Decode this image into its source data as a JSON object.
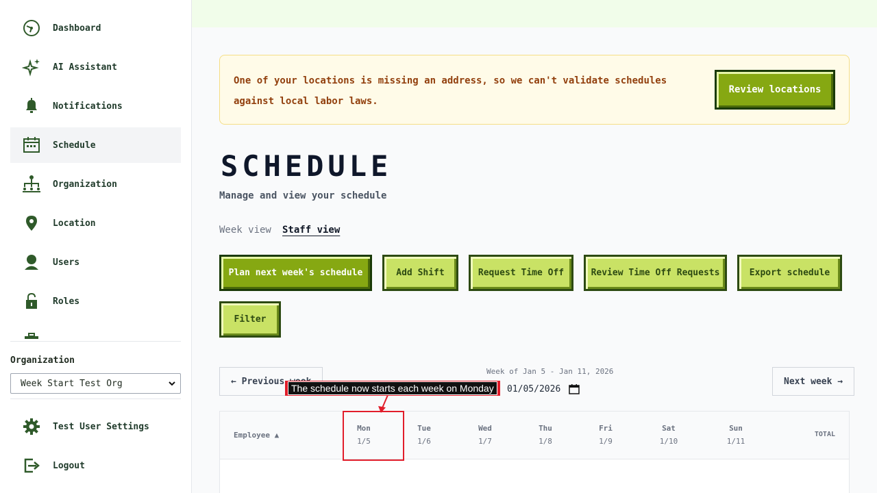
{
  "sidebar": {
    "items": [
      {
        "label": "Dashboard",
        "icon": "gauge-icon"
      },
      {
        "label": "AI Assistant",
        "icon": "sparkle-icon"
      },
      {
        "label": "Notifications",
        "icon": "bell-icon"
      },
      {
        "label": "Schedule",
        "icon": "calendar-icon",
        "active": true
      },
      {
        "label": "Organization",
        "icon": "org-chart-icon"
      },
      {
        "label": "Location",
        "icon": "map-pin-icon"
      },
      {
        "label": "Users",
        "icon": "user-icon"
      },
      {
        "label": "Roles",
        "icon": "lock-icon"
      }
    ],
    "org_label": "Organization",
    "org_selected": "Week Start Test Org",
    "settings_label": "Test User Settings",
    "logout_label": "Logout"
  },
  "alert": {
    "message": "One of your locations is missing an address, so we can't validate schedules against local labor laws.",
    "action_label": "Review locations"
  },
  "page": {
    "title": "SCHEDULE",
    "subtitle": "Manage and view your schedule"
  },
  "views": {
    "week_view": "Week view",
    "staff_view": "Staff view"
  },
  "actions": {
    "plan": "Plan next week's schedule",
    "add_shift": "Add Shift",
    "request_time_off": "Request Time Off",
    "review_time_off": "Review Time Off Requests",
    "export": "Export schedule",
    "filter": "Filter"
  },
  "week_nav": {
    "previous": "← Previous week",
    "next": "Next week →",
    "week_label": "Week of Jan 5 - Jan 11, 2026",
    "date_value": "01/05/2026"
  },
  "grid": {
    "employee_header": "Employee ▲",
    "total_header": "TOTAL",
    "days": [
      {
        "name": "Mon",
        "date": "1/5"
      },
      {
        "name": "Tue",
        "date": "1/6"
      },
      {
        "name": "Wed",
        "date": "1/7"
      },
      {
        "name": "Thu",
        "date": "1/8"
      },
      {
        "name": "Fri",
        "date": "1/9"
      },
      {
        "name": "Sat",
        "date": "1/10"
      },
      {
        "name": "Sun",
        "date": "1/11"
      }
    ]
  },
  "annotation": {
    "text": "The schedule now starts each week on Monday",
    "color": "#e11d2a"
  },
  "colors": {
    "accent_dark": "#86a812",
    "accent_light": "#c9e265",
    "icon_green": "#2f5a2a"
  }
}
